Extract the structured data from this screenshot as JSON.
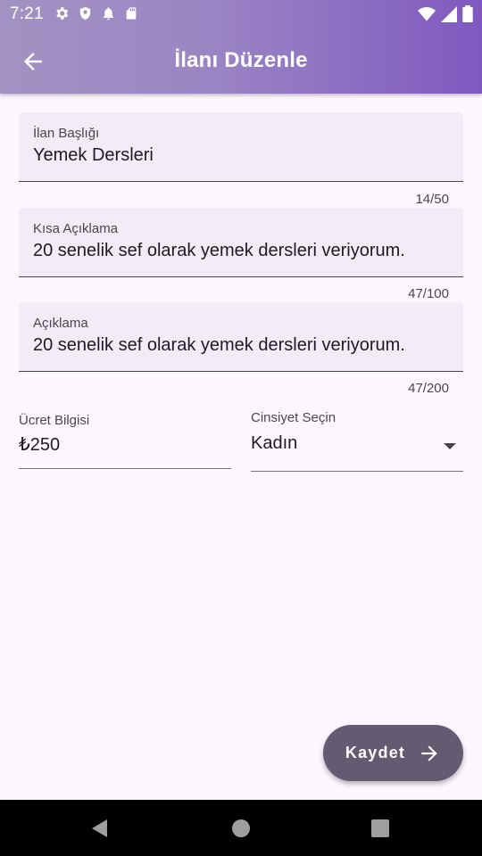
{
  "status_bar": {
    "time": "7:21",
    "left_icons": [
      "gear-icon",
      "shield-icon",
      "bell-icon",
      "sd-card-icon"
    ],
    "right_icons": [
      "wifi-icon",
      "signal-icon",
      "battery-icon"
    ]
  },
  "app_bar": {
    "title": "İlanı Düzenle",
    "back_icon": "arrow-back-icon"
  },
  "form": {
    "title_field": {
      "label": "İlan Başlığı",
      "value": "Yemek Dersleri",
      "counter": "14/50"
    },
    "short_desc_field": {
      "label": "Kısa Açıklama",
      "value": "20 senelik sef olarak yemek dersleri veriyorum.",
      "counter": "47/100"
    },
    "desc_field": {
      "label": "Açıklama",
      "value": "20 senelik sef olarak yemek dersleri veriyorum.",
      "counter": "47/200"
    },
    "price_field": {
      "label": "Ücret Bilgisi",
      "value": "₺250"
    },
    "gender_select": {
      "label": "Cinsiyet Seçin",
      "value": "Kadın"
    }
  },
  "fab": {
    "label": "Kaydet",
    "icon": "arrow-forward-icon"
  },
  "nav_bar": {
    "icons": [
      "back-triangle-icon",
      "home-circle-icon",
      "recents-square-icon"
    ]
  },
  "colors": {
    "app_bar_gradient_start": "#a392c3",
    "app_bar_gradient_end": "#7f59c0",
    "background": "#fef7ff",
    "field_fill": "#f3ecf6",
    "fab": "#625b71"
  }
}
